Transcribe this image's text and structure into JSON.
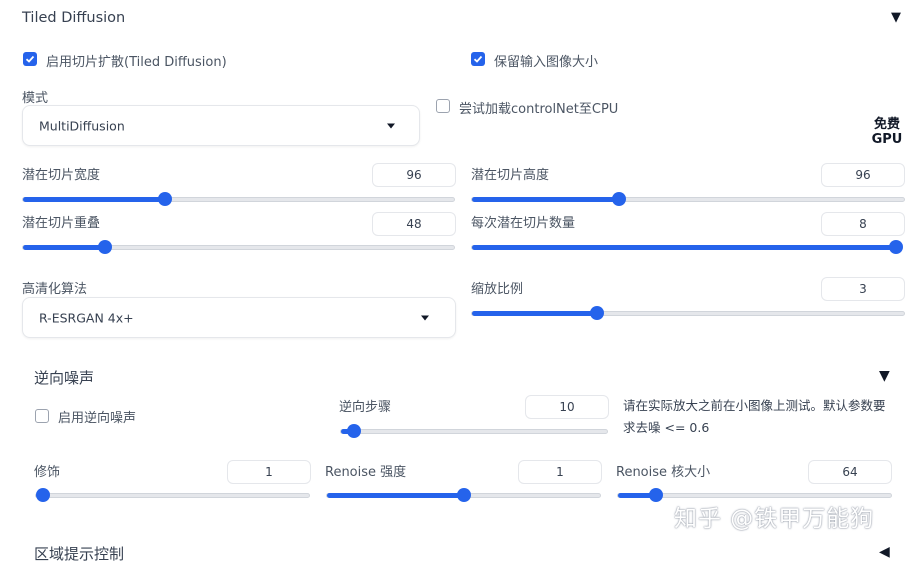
{
  "panel": {
    "title": "Tiled Diffusion",
    "enable_label": "启用切片扩散(Tiled Diffusion)",
    "enable_checked": true,
    "keep_size_label": "保留输入图像大小",
    "keep_size_checked": true,
    "mode_label": "模式",
    "mode_value": "MultiDiffusion",
    "controlnet_label": "尝试加载controlNet至CPU",
    "controlnet_checked": false,
    "free_gpu_label": "免费GPU",
    "tile_width_label": "潜在切片宽度",
    "tile_width_value": "96",
    "tile_width_fraction": 0.33,
    "tile_height_label": "潜在切片高度",
    "tile_height_value": "96",
    "tile_height_fraction": 0.34,
    "tile_overlap_label": "潜在切片重叠",
    "tile_overlap_value": "48",
    "tile_overlap_fraction": 0.19,
    "batch_label": "每次潜在切片数量",
    "batch_value": "8",
    "batch_fraction": 1.0,
    "upscaler_label": "高清化算法",
    "upscaler_value": "R-ESRGAN 4x+",
    "scale_label": "缩放比例",
    "scale_value": "3",
    "scale_fraction": 0.29
  },
  "noise_inversion": {
    "title": "逆向噪声",
    "enable_label": "启用逆向噪声",
    "enable_checked": false,
    "steps_label": "逆向步骤",
    "steps_value": "10",
    "steps_fraction": 0.05,
    "note": "请在实际放大之前在小图像上测试。默认参数要求去噪 <= 0.6",
    "retouch_label": "修饰",
    "retouch_value": "1",
    "retouch_fraction": 0.0,
    "renoise_strength_label": "Renoise 强度",
    "renoise_strength_value": "1",
    "renoise_strength_fraction": 0.5,
    "renoise_kernel_label": "Renoise 核大小",
    "renoise_kernel_value": "64",
    "renoise_kernel_fraction": 0.14
  },
  "next_section": {
    "title": "区域提示控制"
  },
  "watermark": "知乎 @铁甲万能狗"
}
